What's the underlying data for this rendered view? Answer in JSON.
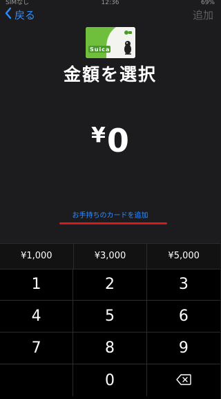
{
  "status": {
    "carrier": "SIMなし",
    "time": "12:36",
    "battery": "69%"
  },
  "nav": {
    "back_label": "戻る",
    "add_label": "追加"
  },
  "card": {
    "brand_text": "Suica"
  },
  "title": "金額を選択",
  "amount": {
    "currency": "¥",
    "value": "0"
  },
  "add_card_link": "お手持ちのカードを追加",
  "presets": [
    "¥1,000",
    "¥3,000",
    "¥5,000"
  ],
  "keys": [
    "1",
    "2",
    "3",
    "4",
    "5",
    "6",
    "7",
    "8",
    "9",
    "",
    "0",
    ""
  ],
  "colors": {
    "accent": "#2f8dff",
    "underline": "#e0151b",
    "card_green": "#6fbf3c"
  }
}
